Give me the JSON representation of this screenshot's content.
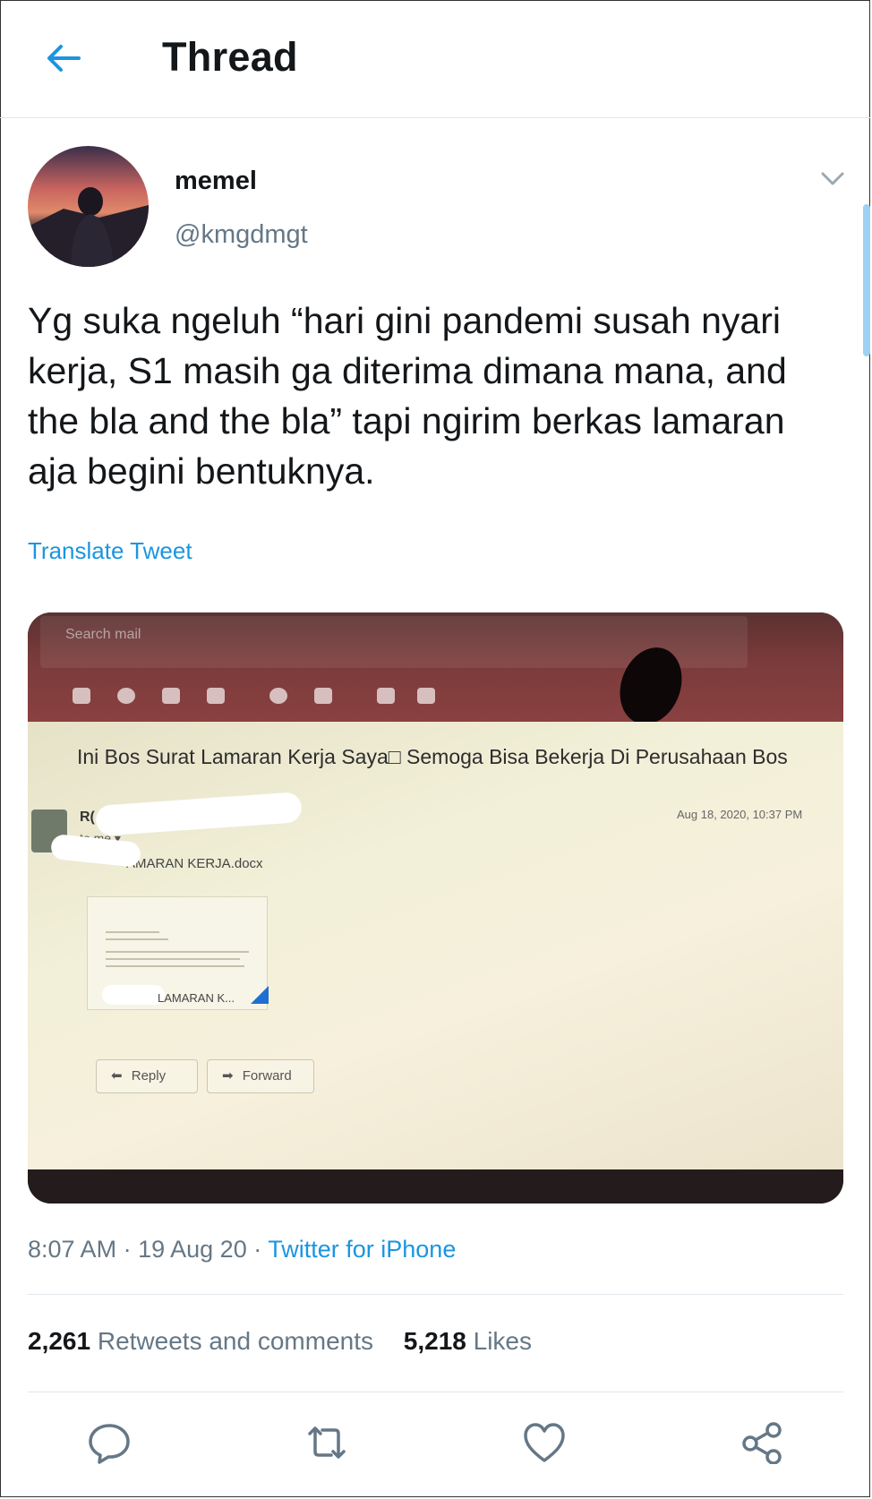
{
  "header": {
    "title": "Thread",
    "back_icon": "arrow-left-icon"
  },
  "tweet": {
    "display_name": "memel",
    "handle": "@kmgdmgt",
    "text": "Yg suka ngeluh “hari gini pandemi susah nyari kerja, S1 masih ga diterima dimana mana, and the bla and the bla” tapi ngirim berkas lamaran aja begini bentuknya.",
    "translate_label": "Translate Tweet",
    "time": "8:07 AM",
    "date": "19 Aug 20",
    "source": "Twitter for iPhone",
    "separator": "·",
    "retweets_count": "2,261",
    "retweets_label": "Retweets and comments",
    "likes_count": "5,218",
    "likes_label": "Likes"
  },
  "media": {
    "search_placeholder": "Search mail",
    "subject": "Ini Bos Surat Lamaran Kerja Saya□ Semoga Bisa Bekerja Di Perusahaan Bos",
    "sender_initials": "R(",
    "to_me": "to me ▾",
    "date": "Aug 18, 2020, 10:37 PM",
    "attachment_name": "AMARAN KERJA.docx",
    "doc_label": "LAMARAN K...",
    "reply_label": "Reply",
    "forward_label": "Forward"
  },
  "actions": [
    "reply-icon",
    "retweet-icon",
    "like-icon",
    "share-icon"
  ],
  "colors": {
    "accent": "#1b95e0",
    "muted": "#657786",
    "text": "#14171a"
  }
}
